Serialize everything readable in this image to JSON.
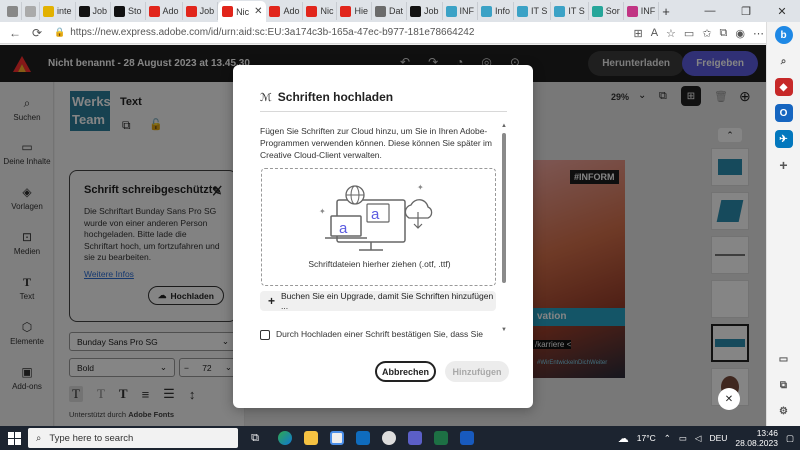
{
  "browser": {
    "tabs": [
      {
        "label": "inte",
        "color": "#e2b100"
      },
      {
        "label": "Job",
        "color": "#111111"
      },
      {
        "label": "Sto",
        "color": "#111111"
      },
      {
        "label": "Ado",
        "color": "#e1251b"
      },
      {
        "label": "Job",
        "color": "#e1251b"
      },
      {
        "label": "Nic",
        "color": "#e1251b",
        "active": true
      },
      {
        "label": "Ado",
        "color": "#e1251b"
      },
      {
        "label": "Nic",
        "color": "#e1251b"
      },
      {
        "label": "Hie",
        "color": "#e1251b"
      },
      {
        "label": "Dat",
        "color": "#6b6b6b"
      },
      {
        "label": "Job",
        "color": "#111111"
      },
      {
        "label": "INF",
        "color": "#3ba2c6"
      },
      {
        "label": "Info",
        "color": "#3ba2c6"
      },
      {
        "label": "IT S",
        "color": "#3ba2c6"
      },
      {
        "label": "IT S",
        "color": "#3ba2c6"
      },
      {
        "label": "Sor",
        "color": "#26a69a"
      },
      {
        "label": "INF",
        "color": "#c13584"
      }
    ],
    "new_tab": "+",
    "url": "https://new.express.adobe.com/id/urn:aid:sc:EU:3a174c3b-165a-47ec-b977-181e78664242"
  },
  "app": {
    "doc_title": "Nicht benannt - 28 August 2023 at 13.45.30",
    "download_label": "Herunterladen",
    "share_label": "Freigeben",
    "zoom": "29%"
  },
  "rail": [
    {
      "label": "Suchen",
      "icon": "search-icon"
    },
    {
      "label": "Deine Inhalte",
      "icon": "folder-icon"
    },
    {
      "label": "Vorlagen",
      "icon": "templates-icon"
    },
    {
      "label": "Medien",
      "icon": "media-icon"
    },
    {
      "label": "Text",
      "icon": "text-icon"
    },
    {
      "label": "Elemente",
      "icon": "elements-icon"
    },
    {
      "label": "Add-ons",
      "icon": "addons-icon"
    }
  ],
  "panel": {
    "title": "Text",
    "logo_text": "Werks Team",
    "locked_title": "Schrift schreibgeschützt",
    "locked_body": "Die Schriftart Bunday Sans Pro SG wurde von einer anderen Person hochgeladen. Bitte lade die Schriftart hoch, um fortzufahren und sie zu bearbeiten.",
    "more_info": "Weitere Infos",
    "upload_label": "Hochladen",
    "font_family": "Bunday Sans Pro SG",
    "font_weight": "Bold",
    "font_size": "72",
    "powered_prefix": "Unterstützt durch ",
    "powered_brand": "Adobe Fonts"
  },
  "poster": {
    "tag": "#INFORM",
    "band": "vation",
    "career": "/karriere <",
    "hashtag": "#WirEntwickelnDichWeiter"
  },
  "modal": {
    "title": "Schriften hochladen",
    "description": "Fügen Sie Schriften zur Cloud hinzu, um Sie in Ihren Adobe-Programmen verwenden können. Diese können Sie später im Creative Cloud-Client verwalten.",
    "drop_text": "Schriftdateien hierher ziehen (.otf, .ttf)",
    "upgrade_text": "Buchen Sie ein Upgrade, damit Sie Schriften hinzufügen ...",
    "consent_text": "Durch Hochladen einer Schrift bestätigen Sie, dass Sie über",
    "cancel_label": "Abbrechen",
    "add_label": "Hinzufügen"
  },
  "taskbar": {
    "search_placeholder": "Type here to search",
    "temperature": "17°C",
    "language": "DEU",
    "time": "13:46",
    "date": "28.08.2023"
  },
  "colors": {
    "accent": "#5c5ce0",
    "app_header": "#1f1f1f",
    "link": "#2c6ed5"
  }
}
